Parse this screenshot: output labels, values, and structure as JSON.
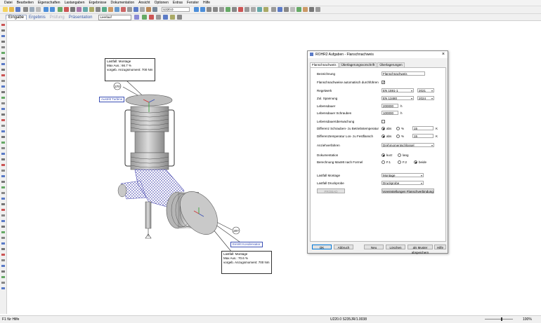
{
  "menu": [
    "Datei",
    "Bearbeiten",
    "Eigenschaften",
    "Lastangaben",
    "Ergebnisse",
    "Dokumentation",
    "Ansicht",
    "Optionen",
    "Extras",
    "Fenster",
    "Hilfe"
  ],
  "toolbar": {
    "zoom_value": "U220.0"
  },
  "tabs": {
    "eingabe": "Eingabe",
    "ergebnis": "Ergebnis",
    "pruefung": "Prüfung",
    "praesentation": "Präsentation"
  },
  "loadcase_select": "Leerlauf",
  "labels": {
    "top_box": {
      "line1": "Lastfall: Montage",
      "line2": "Max Aus.: 66.7 %",
      "line3": "vorgeb. Anzugsmoment: 700 Nm"
    },
    "bottom_box": {
      "line1": "Lastfall: Montage",
      "line2": "Max Aus.: 70.6 %",
      "line3": "vorgeb. Anzugsmoment: 700 Nm"
    },
    "node_top": "270",
    "node_bottom": "207",
    "tag_top": "Austritt Turbine",
    "tag_bottom": "Eintritt Kondensator"
  },
  "dialog": {
    "title": "ROHR2 Aufgaben - Flanschnachweis",
    "tabs": [
      "Flanschnachweis",
      "Überlagerungsvorschrift",
      "Überlagerungen"
    ],
    "bezeichnung_label": "Bezeichnung",
    "bezeichnung_value": "Flanschnachweis",
    "auto_label": "Flanschnachweise automatisch durchführen",
    "auto_checked": "✓",
    "regelwerk_label": "Regelwerk",
    "regelwerk_value": "EN 1591-1",
    "regelwerk_year": "2021",
    "spannung_label": "Zul. Spannung",
    "spannung_value": "EN 13480",
    "spannung_year": "2024",
    "lebensdauer_label": "Lebensdauer",
    "lebensdauer_value": "200000",
    "lebensdauer_unit": "h",
    "schrauben_label": "Lebensdauer Schrauben",
    "schrauben_value": "100000",
    "schrauben_unit": "h",
    "ueberwachung_label": "Lebensdauerüberwachung",
    "diff1_label": "Differenz Schrauben- zu Betriebstemperatur",
    "diff1_abs": "abs",
    "diff1_pct": "%",
    "diff1_value": "15",
    "diff1_unit": "K",
    "diff2_label": "Differenztemperatur Los- zu Festflansch",
    "diff2_abs": "abs",
    "diff2_pct": "%",
    "diff2_value": "15",
    "diff2_unit": "K",
    "anzieh_label": "Anziehverfahren",
    "anzieh_value": "Drehmomentschlüssel",
    "doku_label": "Dokumentation",
    "doku_kurz": "kurz",
    "doku_lang": "lang",
    "berech_label": "Berechnung MaxMt nach Formel",
    "berech_f1": "F.1",
    "berech_f2": "F.2",
    "berech_beide": "beide",
    "lf_montage_label": "Lastfall Montage",
    "lf_montage_value": "Montage",
    "lf_druck_label": "Lastfall Druckprobe",
    "lf_druck_value": "Druckprobe",
    "probad_btn": "PROBAD",
    "voreinst_btn": "Voreinstellungen Flanschverbindung",
    "ok_btn": "OK",
    "abbruch_btn": "Abbruch",
    "neu_btn": "Neu",
    "loeschen_btn": "Löschen",
    "muster_btn": "als Muster abspeichern",
    "hilfe_btn": "Hilfe"
  },
  "status": {
    "left": "F1 für Hilfe",
    "center": "U220.0  S235JR/1.0038",
    "zoom": "100%"
  },
  "colors": {
    "accent": "#3b5eab",
    "mesh": "#4a4ab0",
    "pipe": "#c8c8c8"
  }
}
